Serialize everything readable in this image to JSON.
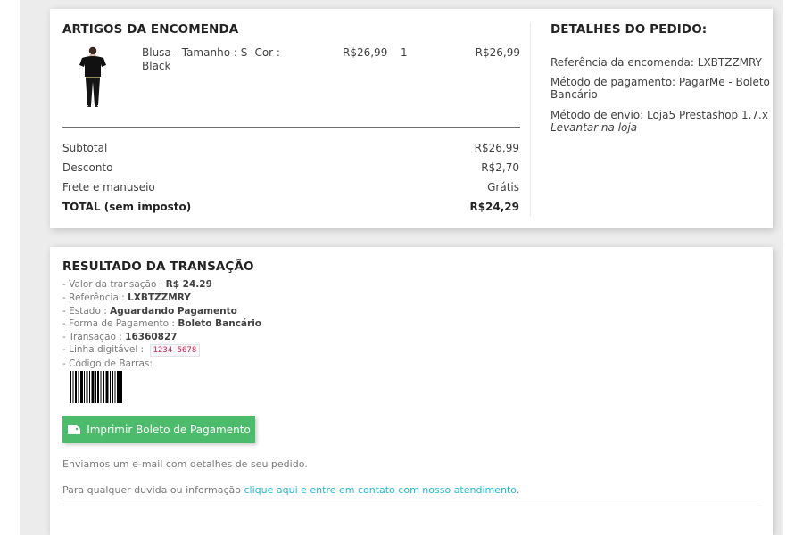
{
  "order_items": {
    "heading": "ARTIGOS DA ENCOMENDA",
    "item": {
      "name": "Blusa - Tamanho : S- Cor : Black",
      "name_line1": "Blusa - Tamanho : S- Cor :",
      "name_line2": "Black",
      "unit_price": "R$26,99",
      "quantity": "1",
      "total": "R$26,99"
    },
    "summary": [
      {
        "label": "Subtotal",
        "value": "R$26,99"
      },
      {
        "label": "Desconto",
        "value": "R$2,70"
      },
      {
        "label": "Frete e manuseio",
        "value": "Grátis"
      },
      {
        "label": "TOTAL (sem imposto)",
        "value": "R$24,29"
      }
    ]
  },
  "order_details": {
    "heading": "DETALHES DO PEDIDO:",
    "reference": "Referência da encomenda: LXBTZZMRY",
    "payment_line1": "Método de pagamento: PagarMe - Boleto",
    "payment_line2": "Bancário",
    "shipping": "Método de envio: Loja5 Prestashop 1.7.x",
    "shipping_note": "Levantar na loja"
  },
  "transaction": {
    "heading": "RESULTADO DA TRANSAÇÃO",
    "rows": [
      {
        "label": "- Valor da transação : ",
        "value": "R$ 24.29"
      },
      {
        "label": "- Referência : ",
        "value": "LXBTZZMRY"
      },
      {
        "label": "- Estado : ",
        "value": "Aguardando Pagamento"
      },
      {
        "label": "- Forma de Pagamento : ",
        "value": "Boleto Bancário"
      },
      {
        "label": "- Transação : ",
        "value": "16360827"
      }
    ],
    "digitable_label": "- Linha digitável : ",
    "digitable_value": "1234 5678",
    "barcode_label": "- Código de Barras:",
    "print_button": "Imprimir Boleto de Pagamento",
    "email_note": "Enviamos um e-mail com detalhes de seu pedido.",
    "contact_prefix": "Para qualquer duvida ou informação ",
    "contact_link": "clique aqui e entre em contato com nosso atendimento",
    "contact_suffix": "."
  },
  "icons": {
    "print": "ticket-icon",
    "product_image": "product-thumbnail"
  },
  "colors": {
    "button": "#4cbb6c",
    "link": "#24b9d7",
    "code_text": "#c7254e"
  }
}
